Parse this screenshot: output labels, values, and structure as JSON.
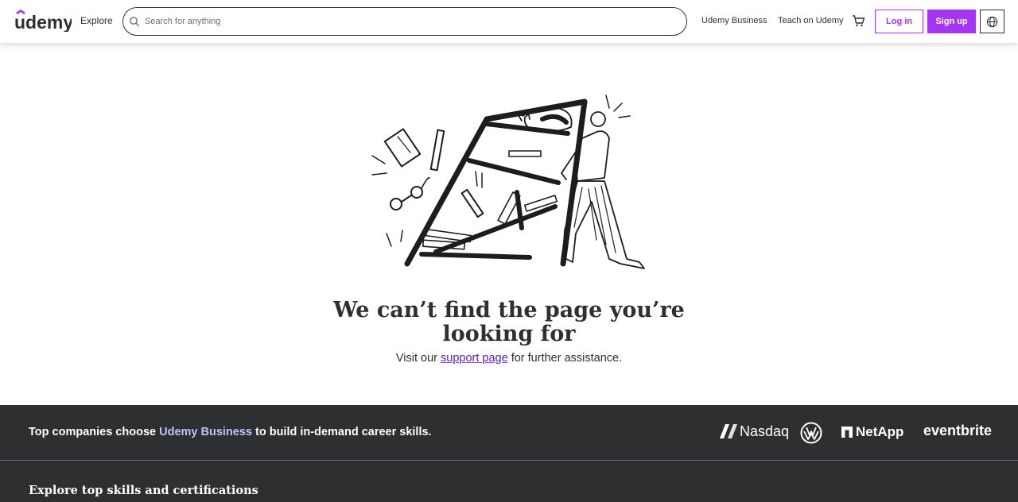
{
  "header": {
    "logo_text": "udemy",
    "explore_label": "Explore",
    "search_placeholder": "Search for anything",
    "nav": {
      "business_label": "Udemy Business",
      "teach_label": "Teach on Udemy"
    },
    "login_label": "Log in",
    "signup_label": "Sign up"
  },
  "main": {
    "title": "We can’t find the page you’re looking for",
    "subtitle_before": "Visit our ",
    "subtitle_link": "support page",
    "subtitle_after": " for further assistance."
  },
  "footer": {
    "tagline_before": "Top companies choose ",
    "tagline_highlight": "Udemy Business",
    "tagline_after": " to build in-demand career skills.",
    "heading": "Explore top skills and certifications",
    "brands": {
      "nasdaq": "Nasdaq",
      "netapp": "NetApp",
      "eventbrite": "eventbrite"
    }
  },
  "colors": {
    "brand_purple": "#a435f0",
    "link_purple": "#5022c3",
    "footer_bg": "#2d2f31",
    "text_dark": "#2d2f31",
    "footer_highlight": "#c0c4fc"
  },
  "icons": [
    "search-icon",
    "cart-icon",
    "globe-icon"
  ]
}
